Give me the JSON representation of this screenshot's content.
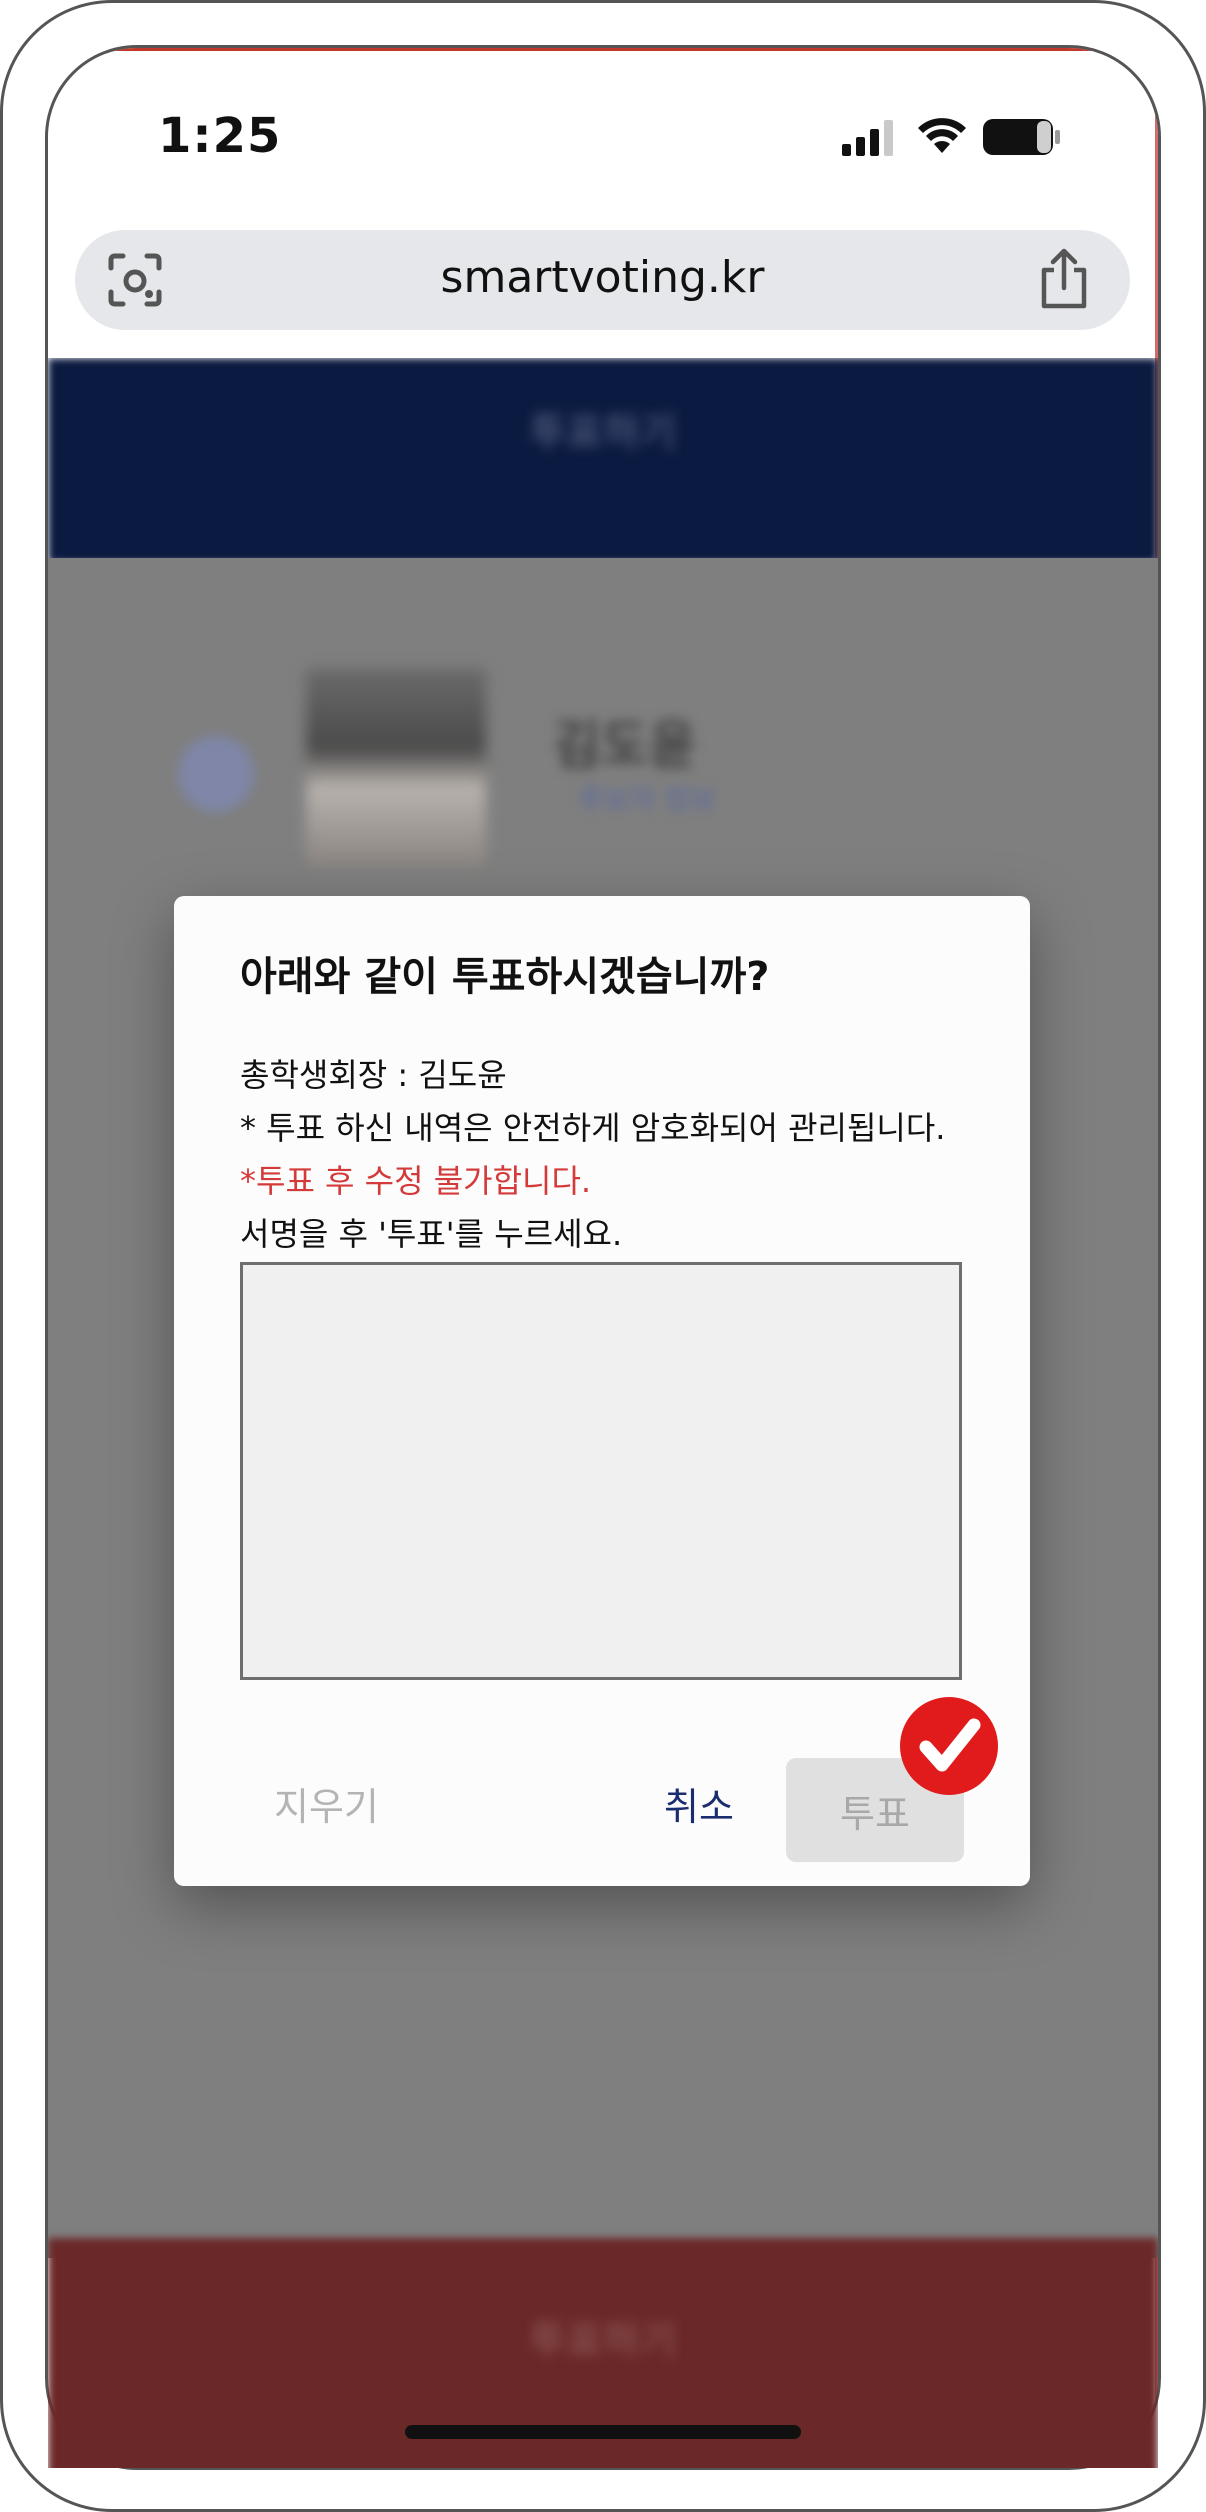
{
  "status_bar": {
    "time": "1:25"
  },
  "browser": {
    "url": "smartvoting.kr"
  },
  "page": {
    "header_label": "투표하기",
    "candidate_name": "김도윤",
    "candidate_link": "후보자 정보",
    "footer_label": "투표하기"
  },
  "dialog": {
    "title": "아래와 같이 투표하시겠습니까?",
    "selection": "총학생회장 : 김도윤",
    "security_notice": "* 투표 하신 내역은 안전하게 암호화되어 관리됩니다.",
    "warning": "*투표 후 수정 불가합니다.",
    "instruction": "서명을 후 '투표'를 누르세요.",
    "clear_label": "지우기",
    "cancel_label": "취소",
    "vote_label": "투표"
  },
  "colors": {
    "header_navy": "#0b1a40",
    "footer_maroon": "#6b2828",
    "warning_red": "#d53a3a",
    "cancel_blue": "#1a2d6e",
    "badge_red": "#e11b1b"
  },
  "icons": [
    "visual-search-icon",
    "share-icon",
    "signal-icon",
    "wifi-icon",
    "battery-icon",
    "checkmark-icon"
  ]
}
